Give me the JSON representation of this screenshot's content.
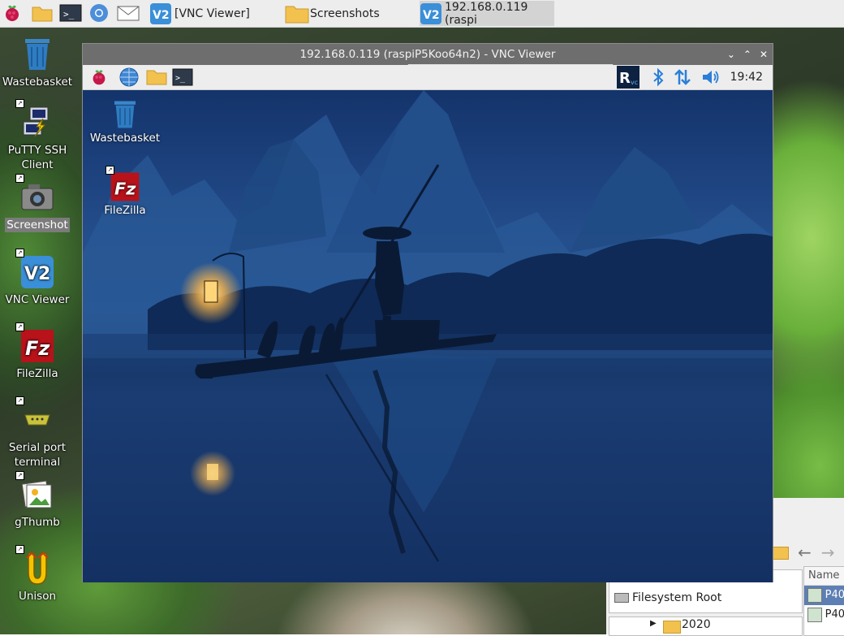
{
  "taskbar": {
    "icons": [
      "raspberry-menu-icon",
      "folder-icon",
      "terminal-icon",
      "chromium-icon",
      "mail-icon"
    ],
    "tasks": [
      {
        "label": "[VNC Viewer]",
        "icon": "vnc-icon"
      },
      {
        "label": "Screenshots",
        "icon": "folder-icon"
      },
      {
        "label": "192.168.0.119 (raspi",
        "icon": "vnc-icon",
        "active": true
      }
    ]
  },
  "desktop": {
    "icons": [
      {
        "label": "Wastebasket",
        "icon": "trash-icon"
      },
      {
        "label": "PuTTY SSH Client",
        "icon": "putty-icon"
      },
      {
        "label": "Screenshot",
        "icon": "camera-icon",
        "selected": true
      },
      {
        "label": "VNC Viewer",
        "icon": "vnc-icon"
      },
      {
        "label": "FileZilla",
        "icon": "filezilla-icon"
      },
      {
        "label": "Serial port terminal",
        "icon": "serial-port-icon"
      },
      {
        "label": "gThumb",
        "icon": "gthumb-icon"
      },
      {
        "label": "Unison",
        "icon": "unison-icon"
      }
    ]
  },
  "vnc_window": {
    "title": "192.168.0.119 (raspiP5Koo64n2) - VNC Viewer",
    "controls": [
      "minimize",
      "maximize",
      "close"
    ],
    "remote_panel": {
      "left_icons": [
        "raspberry-menu-icon",
        "globe-icon",
        "folder-icon",
        "terminal-icon"
      ],
      "right_icons": [
        "realvnc-tray-icon",
        "bluetooth-icon",
        "network-icon",
        "volume-icon"
      ],
      "clock": "19:42"
    },
    "remote_desktop": {
      "icons": [
        {
          "label": "Wastebasket",
          "icon": "trash-icon"
        },
        {
          "label": "FileZilla",
          "icon": "filezilla-icon"
        }
      ]
    }
  },
  "file_manager": {
    "tree_root": "Filesystem Root",
    "tree_child": "2020",
    "list_header": "Name",
    "rows": [
      "P40",
      "P40"
    ]
  }
}
